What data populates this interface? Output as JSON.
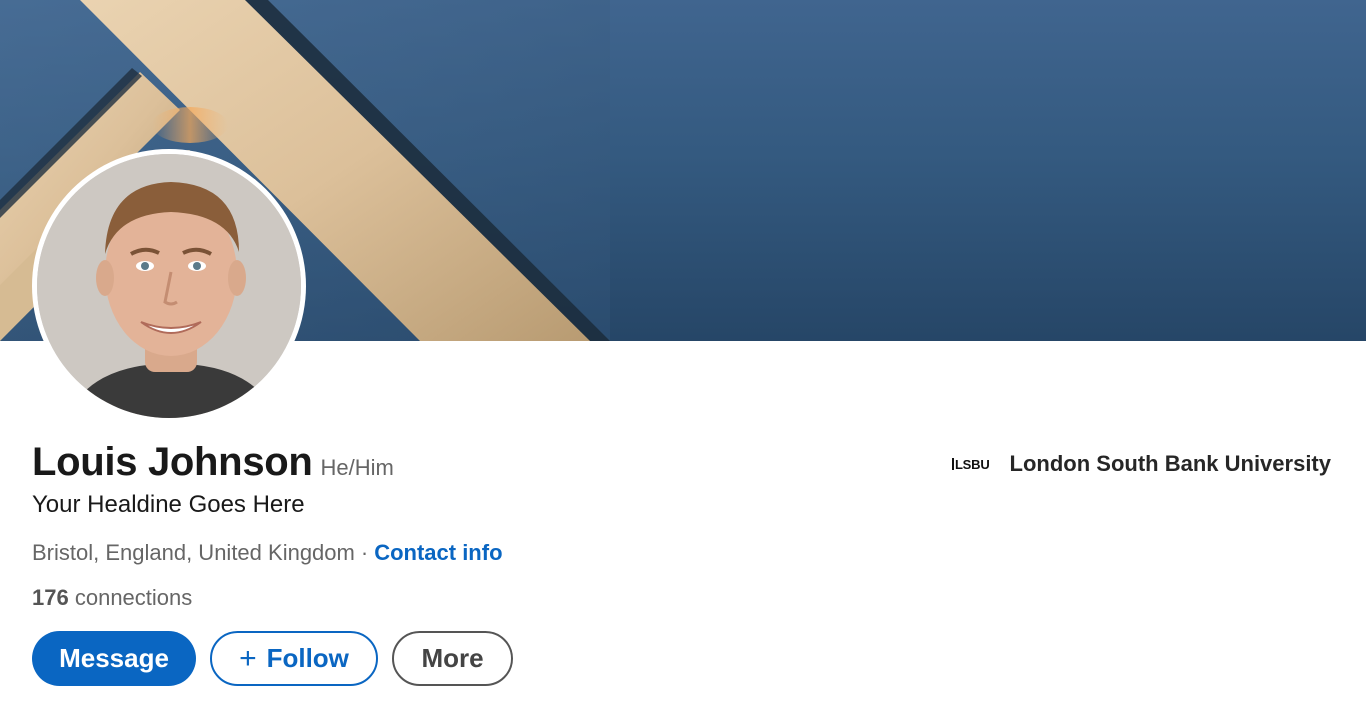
{
  "profile": {
    "name": "Louis Johnson",
    "pronouns": "He/Him",
    "headline": "Your Healdine Goes Here",
    "location": "Bristol, England, United Kingdom",
    "separator": "·",
    "contact_info": "Contact info",
    "connections_count": "176",
    "connections_label": "connections"
  },
  "actions": {
    "message": "Message",
    "follow_icon": "+",
    "follow": "Follow",
    "more": "More"
  },
  "education": {
    "logo_text": "LSBU",
    "name": "London South Bank University"
  },
  "colors": {
    "accent": "#0a66c2",
    "banner": "#345a80"
  },
  "icons": {
    "follow": "plus-icon"
  }
}
